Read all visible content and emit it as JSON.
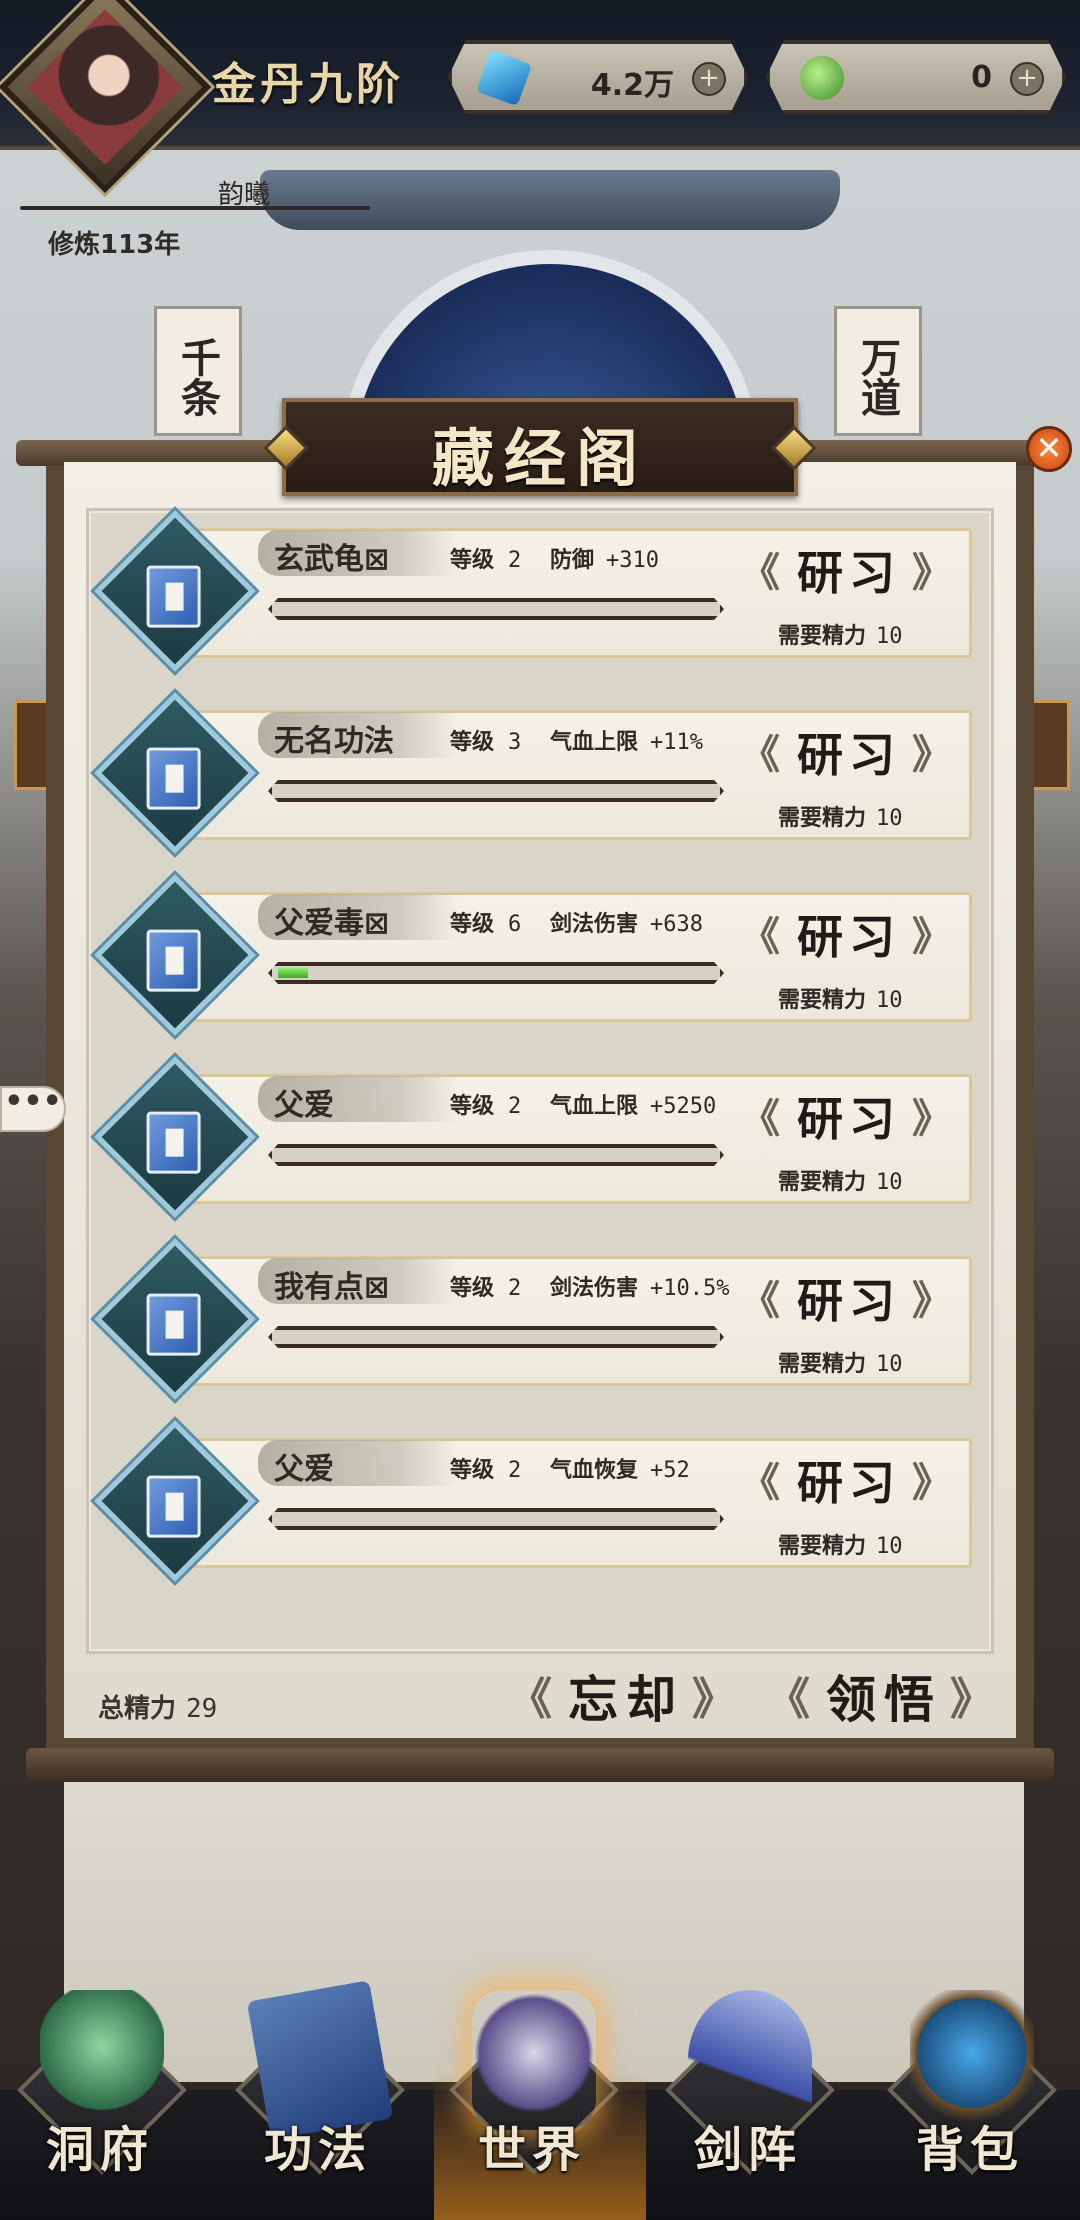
{
  "header": {
    "realm": "金丹九阶",
    "player_name": "韵曦",
    "cultivation": "修炼113年",
    "resources": [
      {
        "icon": "spirit-stone-icon",
        "value": "4.2万"
      },
      {
        "icon": "jade-icon",
        "value": "0"
      }
    ]
  },
  "scene": {
    "banner_left": "千条",
    "banner_right": "万道"
  },
  "panel": {
    "title": "藏经阁",
    "close_symbol": "✕",
    "level_label": "等级",
    "need_label": "需要精力",
    "study_label": "研习",
    "skills": [
      {
        "name": "玄武龟⊠",
        "level": "2",
        "effect": "防御",
        "value": "+310",
        "need": "10",
        "progress": 0.0
      },
      {
        "name": "无名功法",
        "level": "3",
        "effect": "气血上限",
        "value": "+11%",
        "need": "10",
        "progress": 0.0
      },
      {
        "name": "父爱毒⊠",
        "level": "6",
        "effect": "剑法伤害",
        "value": "+638",
        "need": "10",
        "progress": 0.07
      },
      {
        "name": "父爱",
        "level": "2",
        "effect": "气血上限",
        "value": "+5250",
        "need": "10",
        "progress": 0.0
      },
      {
        "name": "我有点⊠",
        "level": "2",
        "effect": "剑法伤害",
        "value": "+10.5%",
        "need": "10",
        "progress": 0.0
      },
      {
        "name": "父爱",
        "level": "2",
        "effect": "气血恢复",
        "value": "+52",
        "need": "10",
        "progress": 0.0
      }
    ],
    "total_label": "总精力",
    "total_value": "29",
    "forget_label": "忘却",
    "comprehend_label": "领悟"
  },
  "chat": {
    "symbol": "•••"
  },
  "nav": [
    {
      "label": "洞府",
      "icon": "cave-icon"
    },
    {
      "label": "功法",
      "icon": "scripture-icon"
    },
    {
      "label": "世界",
      "icon": "world-icon",
      "active": true
    },
    {
      "label": "剑阵",
      "icon": "sword-array-icon"
    },
    {
      "label": "背包",
      "icon": "bag-icon"
    }
  ],
  "colors": {
    "paper": "#f2efe6",
    "plaque": "#3c2c22",
    "progress_fill": "#5ad23a",
    "accent_gold": "#e9d6a6"
  }
}
